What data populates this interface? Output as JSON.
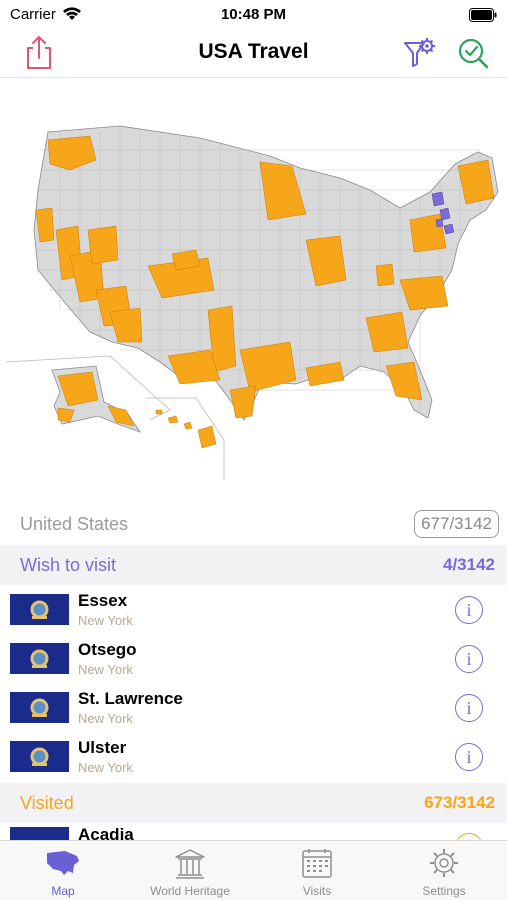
{
  "status": {
    "carrier": "Carrier",
    "time": "10:48 PM"
  },
  "nav": {
    "title": "USA Travel"
  },
  "summary": {
    "label": "United States",
    "count": "677/3142"
  },
  "wish": {
    "title": "Wish to visit",
    "count": "4/3142",
    "items": [
      {
        "name": "Essex",
        "state": "New York"
      },
      {
        "name": "Otsego",
        "state": "New York"
      },
      {
        "name": "St. Lawrence",
        "state": "New York"
      },
      {
        "name": "Ulster",
        "state": "New York"
      }
    ]
  },
  "visited": {
    "title": "Visited",
    "count": "673/3142",
    "items": [
      {
        "name": "Acadia"
      }
    ]
  },
  "tabs": [
    {
      "label": "Map",
      "icon": "map-icon"
    },
    {
      "label": "World Heritage",
      "icon": "temple-icon"
    },
    {
      "label": "Visits",
      "icon": "calendar-icon"
    },
    {
      "label": "Settings",
      "icon": "gear-icon"
    }
  ],
  "colors": {
    "accent": "#6b5fd6",
    "visited": "#f7a519",
    "wish": "#7b6ad7",
    "map_base": "#d9d9d9",
    "share": "#e0566d",
    "check": "#2aa35c"
  }
}
